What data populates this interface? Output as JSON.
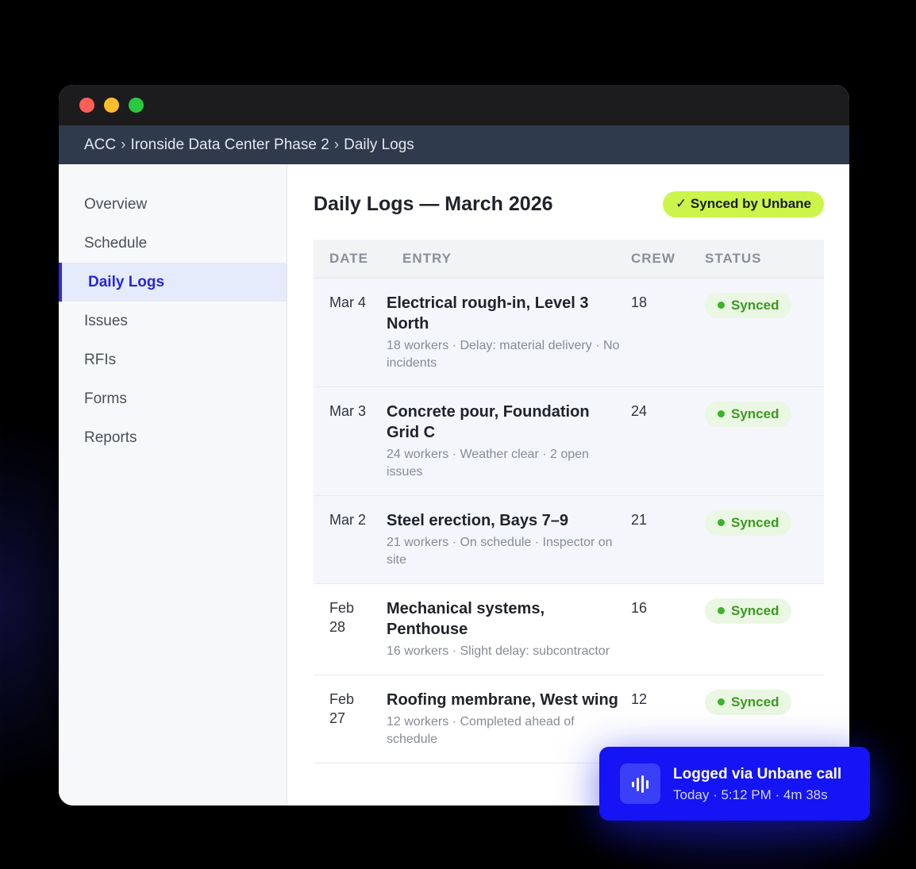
{
  "breadcrumb": [
    "ACC",
    "Ironside Data Center Phase 2",
    "Daily Logs"
  ],
  "breadcrumb_separator": "›",
  "sidebar": {
    "items": [
      {
        "label": "Overview"
      },
      {
        "label": "Schedule"
      },
      {
        "label": "Daily Logs",
        "active": true
      },
      {
        "label": "Issues"
      },
      {
        "label": "RFIs"
      },
      {
        "label": "Forms"
      },
      {
        "label": "Reports"
      }
    ]
  },
  "main": {
    "title": "Daily Logs — March 2026",
    "synced_badge": "✓ Synced by Unbane",
    "table": {
      "headers": [
        "DATE",
        "ENTRY",
        "CREW",
        "STATUS"
      ],
      "rows": [
        {
          "date": "Mar 4",
          "title": "Electrical rough-in, Level 3 North",
          "meta": "18 workers · Delay: material delivery · No incidents",
          "crew": "18",
          "status": "Synced"
        },
        {
          "date": "Mar 3",
          "title": "Concrete pour, Foundation Grid C",
          "meta": "24 workers · Weather clear · 2 open issues",
          "crew": "24",
          "status": "Synced"
        },
        {
          "date": "Mar 2",
          "title": "Steel erection, Bays 7–9",
          "meta": "21 workers · On schedule · Inspector on site",
          "crew": "21",
          "status": "Synced"
        },
        {
          "date": "Feb 28",
          "title": "Mechanical systems, Penthouse",
          "meta": "16 workers · Slight delay: subcontractor",
          "crew": "16",
          "status": "Synced"
        },
        {
          "date": "Feb 27",
          "title": "Roofing membrane, West wing",
          "meta": "12 workers · Completed ahead of schedule",
          "crew": "12",
          "status": "Synced"
        }
      ]
    }
  },
  "toast": {
    "title": "Logged via Unbane call",
    "subtitle": "Today · 5:12 PM · 4m 38s",
    "icon": "audio-waveform-icon"
  },
  "colors": {
    "accent": "#2426e0",
    "synced_badge_bg": "#cbf54a",
    "status_green": "#3a9a22",
    "toast_bg": "#1414f5"
  }
}
